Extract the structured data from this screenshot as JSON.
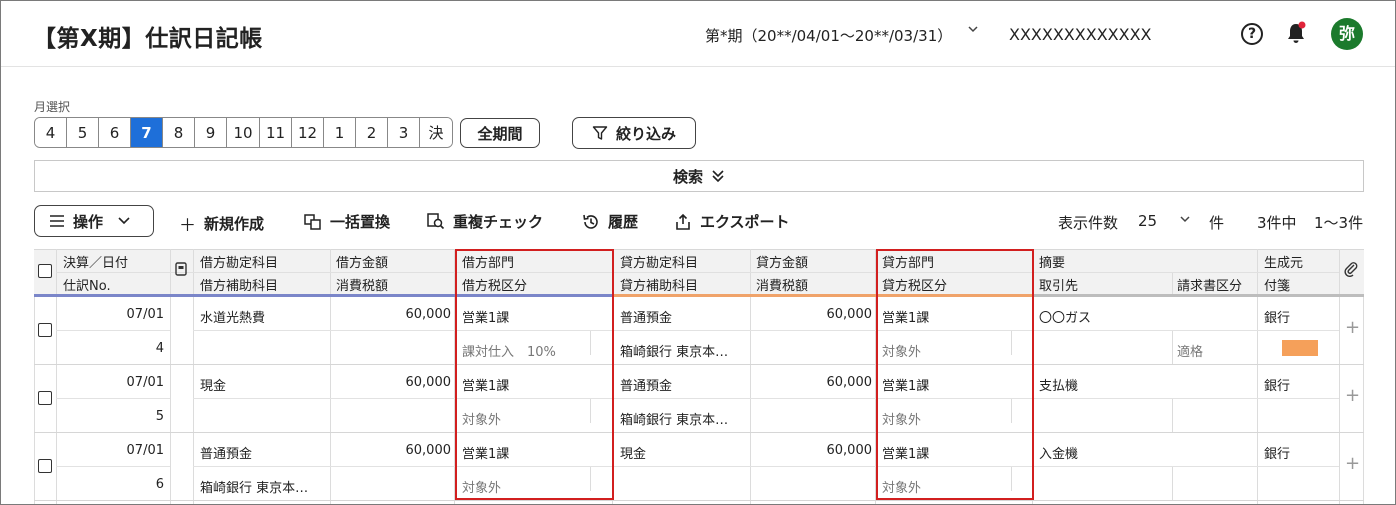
{
  "header": {
    "title": "【第X期】仕訳日記帳",
    "period": "第*期（20**/04/01〜20**/03/31）",
    "company": "XXXXXXXXXXXXX",
    "help_icon": "?",
    "avatar": "弥"
  },
  "month_selector": {
    "label": "月選択",
    "months": [
      "4",
      "5",
      "6",
      "7",
      "8",
      "9",
      "10",
      "11",
      "12",
      "1",
      "2",
      "3",
      "決"
    ],
    "selected": "7",
    "all_period_label": "全期間",
    "filter_label": "絞り込み"
  },
  "search": {
    "label": "検索"
  },
  "toolbar": {
    "operations_label": "操作",
    "new_label": "新規作成",
    "bulk_replace_label": "一括置換",
    "duplicate_check_label": "重複チェック",
    "history_label": "履歴",
    "export_label": "エクスポート",
    "display_count_label": "表示件数",
    "display_count": "25",
    "count_unit": "件",
    "total": "3件中",
    "range": "1〜3件"
  },
  "columns": {
    "date": "決算／日付",
    "entry_no": "仕訳No.",
    "debit_account": "借方勘定科目",
    "debit_sub": "借方補助科目",
    "debit_amount": "借方金額",
    "debit_tax_amount": "消費税額",
    "debit_dept": "借方部門",
    "debit_tax_class": "借方税区分",
    "credit_account": "貸方勘定科目",
    "credit_sub": "貸方補助科目",
    "credit_amount": "貸方金額",
    "credit_tax_amount": "消費税額",
    "credit_dept": "貸方部門",
    "credit_tax_class": "貸方税区分",
    "summary": "摘要",
    "partner": "取引先",
    "invoice_class": "請求書区分",
    "source": "生成元",
    "sticky": "付箋"
  },
  "rows": [
    {
      "date": "07/01",
      "no": "4",
      "debit_account": "水道光熱費",
      "debit_sub": "",
      "debit_amount": "60,000",
      "debit_tax_amount": "",
      "debit_dept": "営業1課",
      "debit_tax_class": "課対仕入　10%",
      "credit_account": "普通預金",
      "credit_sub": "箱崎銀行 東京本…",
      "credit_amount": "60,000",
      "credit_tax_amount": "",
      "credit_dept": "営業1課",
      "credit_tax_class": "対象外",
      "summary": "〇〇ガス",
      "partner": "",
      "invoice_class": "適格",
      "source": "銀行",
      "sticky_color": "#f5a05a"
    },
    {
      "date": "07/01",
      "no": "5",
      "debit_account": "現金",
      "debit_sub": "",
      "debit_amount": "60,000",
      "debit_tax_amount": "",
      "debit_dept": "営業1課",
      "debit_tax_class": "対象外",
      "credit_account": "普通預金",
      "credit_sub": "箱崎銀行 東京本…",
      "credit_amount": "60,000",
      "credit_tax_amount": "",
      "credit_dept": "営業1課",
      "credit_tax_class": "対象外",
      "summary": "支払機",
      "partner": "",
      "invoice_class": "",
      "source": "銀行"
    },
    {
      "date": "07/01",
      "no": "6",
      "debit_account": "普通預金",
      "debit_sub": "箱崎銀行 東京本…",
      "debit_amount": "60,000",
      "debit_tax_amount": "",
      "debit_dept": "営業1課",
      "debit_tax_class": "対象外",
      "credit_account": "現金",
      "credit_sub": "",
      "credit_amount": "60,000",
      "credit_tax_amount": "",
      "credit_dept": "営業1課",
      "credit_tax_class": "対象外",
      "summary": "入金機",
      "partner": "",
      "invoice_class": "",
      "source": "銀行"
    }
  ],
  "colors": {
    "accent": "#1e6fd9",
    "highlight_box": "#d21f1f",
    "debit_bar": "#7b86c9",
    "credit_bar": "#f0a36a",
    "avatar_bg": "#1b7a2c"
  }
}
